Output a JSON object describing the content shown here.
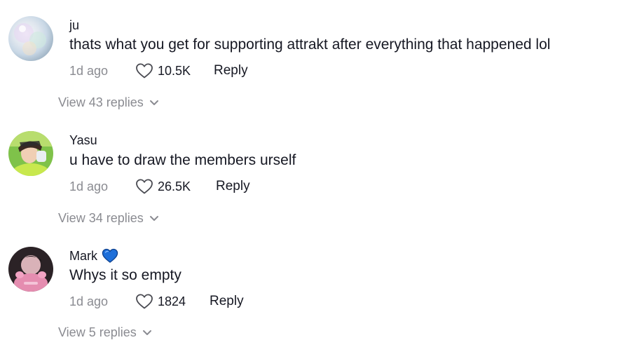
{
  "comments": [
    {
      "username": "ju",
      "text": "thats what you get for supporting attrakt after everything that happened lol",
      "time": "1d ago",
      "likes": "10.5K",
      "reply_label": "Reply",
      "view_replies": "View 43 replies"
    },
    {
      "username": "Yasu",
      "text": "u have to draw the members urself",
      "time": "1d ago",
      "likes": "26.5K",
      "reply_label": "Reply",
      "view_replies": "View 34 replies"
    },
    {
      "username": "Mark",
      "text": "Whys it so empty",
      "time": "1d ago",
      "likes": "1824",
      "reply_label": "Reply",
      "view_replies": "View 5 replies"
    }
  ],
  "colors": {
    "text_primary": "#161823",
    "text_secondary": "#8a8b91",
    "verified_heart": "#1e6fd9"
  }
}
